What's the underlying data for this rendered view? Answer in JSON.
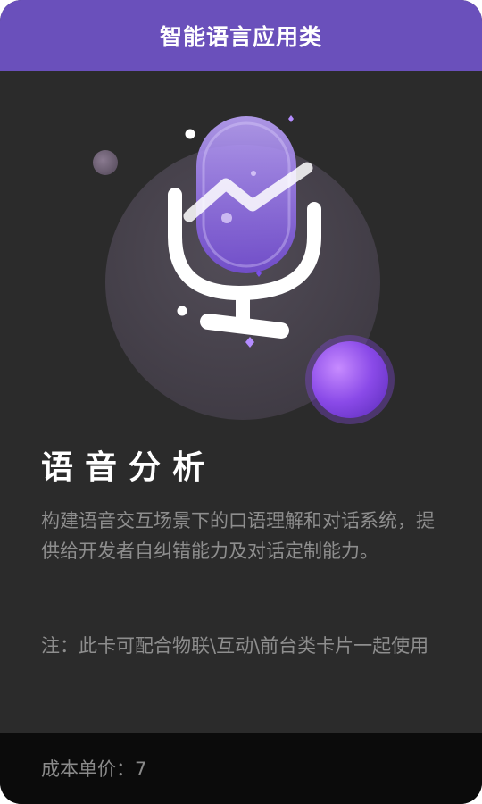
{
  "header": {
    "title": "智能语言应用类"
  },
  "card": {
    "icon": "microphone-icon",
    "title": "语音分析",
    "description": "构建语音交互场景下的口语理解和对话系统，提供给开发者自纠错能力及对话定制能力。",
    "note": "注：此卡可配合物联\\互动\\前台类卡片一起使用"
  },
  "footer": {
    "cost_label": "成本单价：",
    "cost_value": "7"
  },
  "colors": {
    "header_bg": "#6a50bb",
    "card_bg": "#2b2b2b",
    "footer_bg": "#0b0b0b",
    "accent_purple": "#9a6cf0"
  }
}
